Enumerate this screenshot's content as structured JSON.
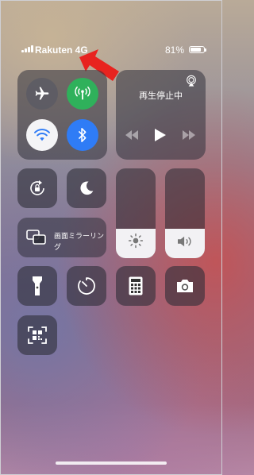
{
  "status_bar": {
    "carrier": "Rakuten 4G",
    "battery_percent_text": "81%",
    "battery_level": 0.81,
    "signal_bars": 4
  },
  "connectivity": {
    "airplane": {
      "icon": "airplane-icon",
      "active": false
    },
    "cellular": {
      "icon": "cellular-antenna-icon",
      "active": true,
      "color": "#2fb15b"
    },
    "wifi": {
      "icon": "wifi-icon",
      "active": true
    },
    "bluetooth": {
      "icon": "bluetooth-icon",
      "active": true,
      "color": "#2f7cf6"
    }
  },
  "music": {
    "title": "再生停止中",
    "icons": [
      "airplay-icon",
      "rewind-icon",
      "play-icon",
      "fast-forward-icon"
    ]
  },
  "toggles": {
    "rotation_lock": {
      "icon": "rotation-lock-icon"
    },
    "do_not_disturb": {
      "icon": "moon-icon"
    }
  },
  "screen_mirroring": {
    "label": "画面ミラーリング",
    "icon": "screen-mirroring-icon"
  },
  "sliders": {
    "brightness": {
      "icon": "sun-icon",
      "level": 0.33
    },
    "volume": {
      "icon": "speaker-icon",
      "level": 0.33
    }
  },
  "shortcuts": [
    {
      "icon": "flashlight-icon"
    },
    {
      "icon": "timer-icon"
    },
    {
      "icon": "calculator-icon"
    },
    {
      "icon": "camera-icon"
    },
    {
      "icon": "qr-code-scanner-icon"
    }
  ],
  "annotation": {
    "color": "#e8231f",
    "icon": "red-arrow-icon"
  }
}
